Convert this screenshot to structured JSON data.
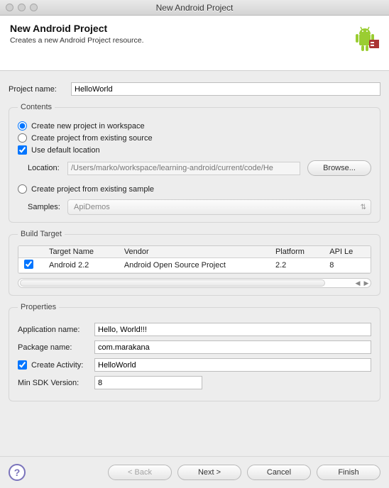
{
  "window": {
    "title": "New Android Project"
  },
  "header": {
    "title": "New Android Project",
    "subtitle": "Creates a new Android Project resource."
  },
  "projectName": {
    "label": "Project name:",
    "value": "HelloWorld"
  },
  "contents": {
    "legend": "Contents",
    "opt_new": "Create new project in workspace",
    "opt_existing": "Create project from existing source",
    "opt_defaultloc": "Use default location",
    "locationLabel": "Location:",
    "locationValue": "/Users/marko/workspace/learning-android/current/code/He",
    "browse": "Browse...",
    "opt_sample": "Create project from existing sample",
    "samplesLabel": "Samples:",
    "samplesValue": "ApiDemos"
  },
  "buildTarget": {
    "legend": "Build Target",
    "cols": {
      "name": "Target Name",
      "vendor": "Vendor",
      "platform": "Platform",
      "api": "API Le"
    },
    "rows": [
      {
        "checked": true,
        "name": "Android 2.2",
        "vendor": "Android Open Source Project",
        "platform": "2.2",
        "api": "8"
      }
    ]
  },
  "properties": {
    "legend": "Properties",
    "appNameLabel": "Application name:",
    "appNameValue": "Hello, World!!!",
    "pkgLabel": "Package name:",
    "pkgValue": "com.marakana",
    "createActivityLabel": "Create Activity:",
    "createActivityValue": "HelloWorld",
    "minSdkLabel": "Min SDK Version:",
    "minSdkValue": "8"
  },
  "footer": {
    "back": "< Back",
    "next": "Next >",
    "cancel": "Cancel",
    "finish": "Finish"
  }
}
